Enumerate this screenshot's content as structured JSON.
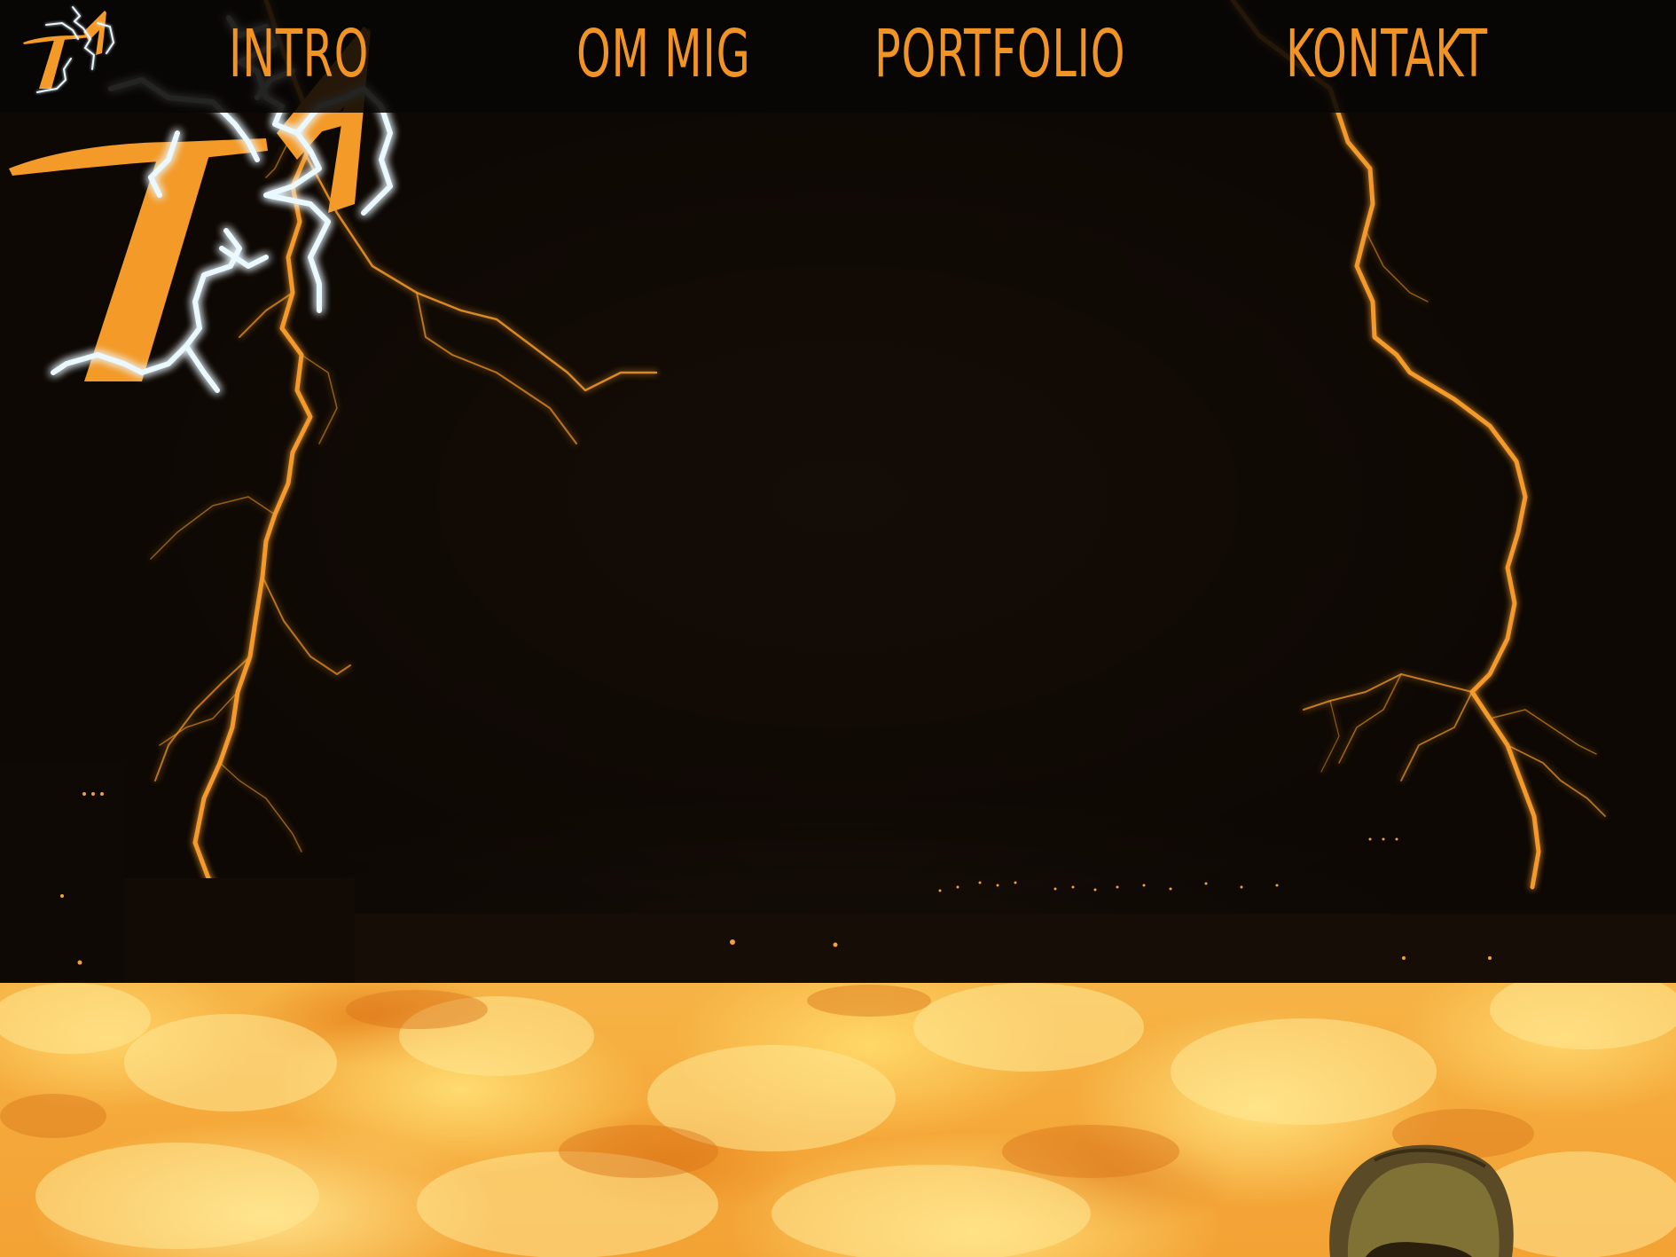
{
  "nav": {
    "items": [
      {
        "label": "INTRO"
      },
      {
        "label": "OM MIG"
      },
      {
        "label": "PORTFOLIO"
      },
      {
        "label": "KONTAKT"
      }
    ],
    "logo_letters": {
      "primary": "T",
      "secondary": "A"
    }
  },
  "hero": {
    "logo_letters": {
      "primary": "T",
      "secondary": "A"
    },
    "background": "lightning storm over city at night"
  },
  "colors": {
    "accent": "#f29424",
    "nav_bg": "#080604",
    "lightning_glow": "#8fd8ff",
    "cloud": "#f6b446"
  },
  "icons": {
    "logo": "ta-lightning-logo-icon",
    "person": "person-cap-photo"
  }
}
